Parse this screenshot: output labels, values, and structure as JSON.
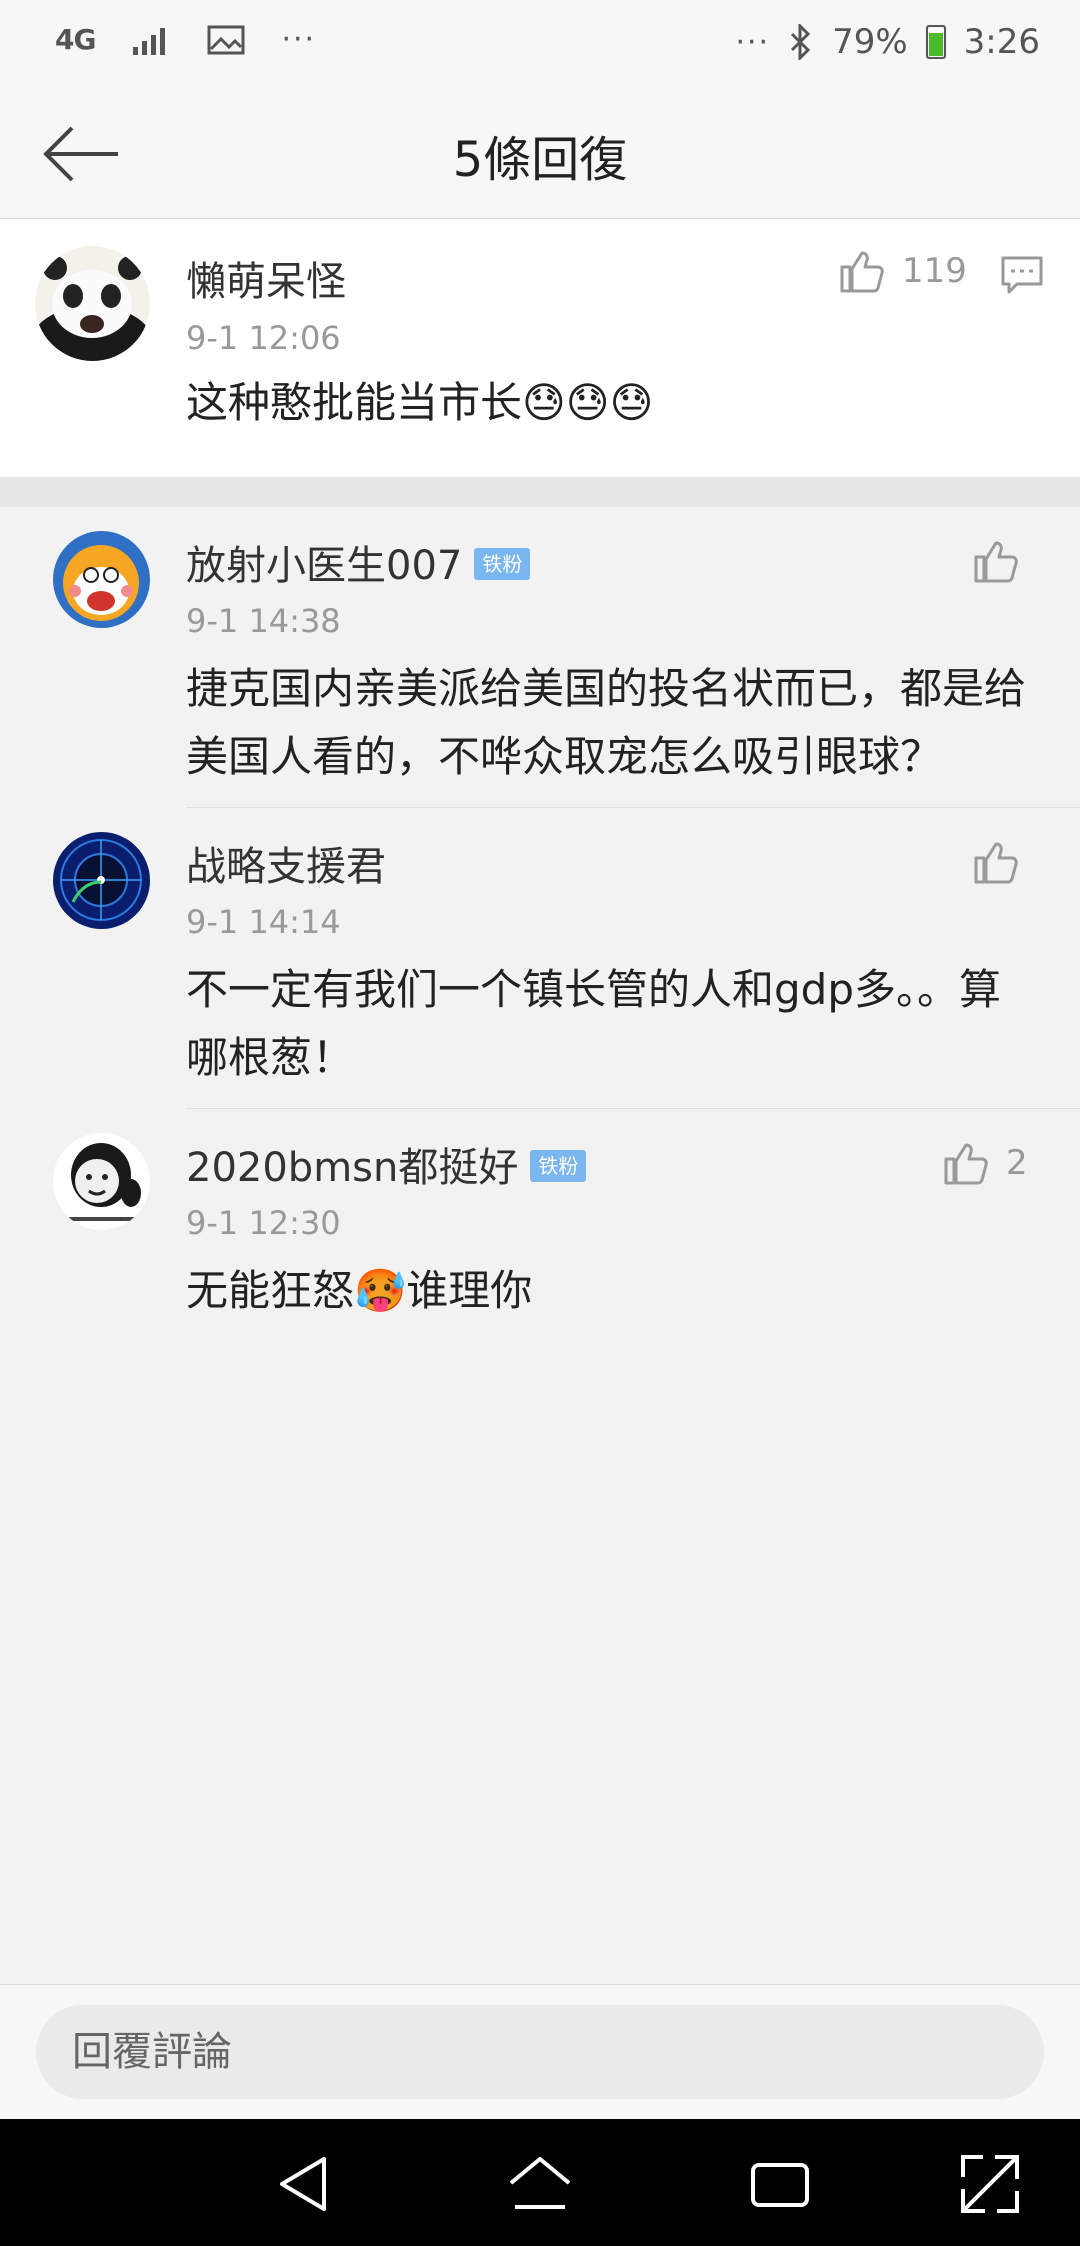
{
  "status_bar": {
    "network": "4G",
    "battery_percent": "79%",
    "time": "3:26",
    "dots": "···"
  },
  "header": {
    "title": "5條回復"
  },
  "main_comment": {
    "username": "懶萌呆怪",
    "time": "9-1 12:06",
    "text": "这种憨批能当市长😓😓😓",
    "likes": "119"
  },
  "replies": [
    {
      "username": "放射小医生007",
      "badge": "铁粉",
      "time": "9-1 14:38",
      "text": "捷克国内亲美派给美国的投名状而已，都是给美国人看的，不哗众取宠怎么吸引眼球？",
      "likes": ""
    },
    {
      "username": "战略支援君",
      "badge": "",
      "time": "9-1 14:14",
      "text": "不一定有我们一个镇长管的人和gdp多。。算哪根葱！",
      "likes": ""
    },
    {
      "username": "2020bmsn都挺好",
      "badge": "铁粉",
      "time": "9-1 12:30",
      "text": "无能狂怒🥵谁理你",
      "likes": "2"
    }
  ],
  "bottom_bar": {
    "placeholder": "回覆評論"
  },
  "icons": {
    "back": "arrow-left-icon",
    "like": "thumbs-up-icon",
    "comment": "comment-icon",
    "nav_back": "triangle-back-icon",
    "nav_home": "home-icon",
    "nav_recent": "recent-apps-icon",
    "nav_expand": "expand-icon"
  }
}
